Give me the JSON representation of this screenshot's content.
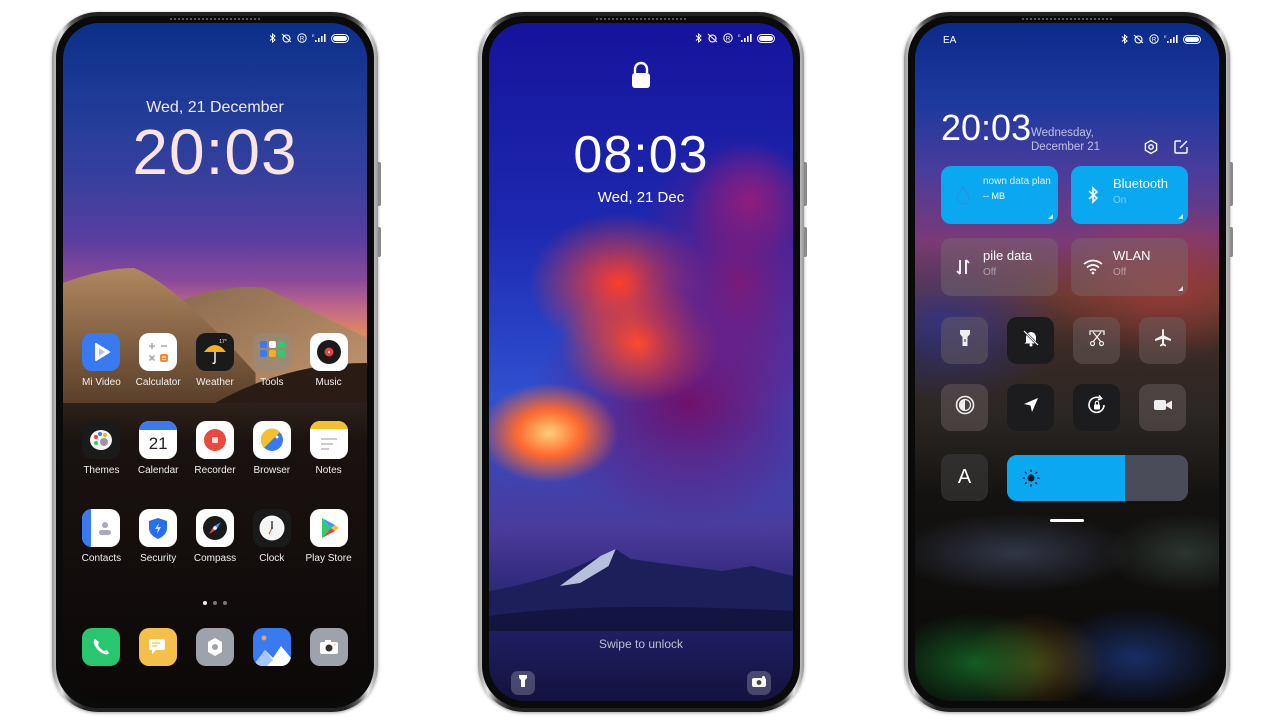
{
  "status_bar": {
    "icons": [
      "bluetooth-icon",
      "silent-alarm-icon",
      "registered-r-icon",
      "signal-e-icon",
      "battery-icon"
    ],
    "signal_label": "E"
  },
  "home_screen": {
    "date": "Wed, 21 December",
    "time": "20:03",
    "apps": [
      {
        "label": "Mi Video",
        "icon": "mi-video-icon"
      },
      {
        "label": "Calculator",
        "icon": "calculator-icon"
      },
      {
        "label": "Weather",
        "icon": "weather-icon",
        "badge": "17°"
      },
      {
        "label": "Tools",
        "icon": "tools-folder-icon"
      },
      {
        "label": "Music",
        "icon": "music-icon"
      },
      {
        "label": "Themes",
        "icon": "themes-icon"
      },
      {
        "label": "Calendar",
        "icon": "calendar-icon",
        "day": "21"
      },
      {
        "label": "Recorder",
        "icon": "recorder-icon"
      },
      {
        "label": "Browser",
        "icon": "browser-icon"
      },
      {
        "label": "Notes",
        "icon": "notes-icon"
      },
      {
        "label": "Contacts",
        "icon": "contacts-icon"
      },
      {
        "label": "Security",
        "icon": "security-icon"
      },
      {
        "label": "Compass",
        "icon": "compass-icon"
      },
      {
        "label": "Clock",
        "icon": "clock-icon"
      },
      {
        "label": "Play Store",
        "icon": "play-store-icon"
      }
    ],
    "page_indicator": {
      "pages": 3,
      "current": 1
    },
    "dock": [
      {
        "name": "phone",
        "icon": "phone-icon"
      },
      {
        "name": "messages",
        "icon": "messages-icon"
      },
      {
        "name": "settings",
        "icon": "settings-icon"
      },
      {
        "name": "gallery",
        "icon": "gallery-icon"
      },
      {
        "name": "camera",
        "icon": "camera-icon"
      }
    ]
  },
  "lock_screen": {
    "time": "08:03",
    "date": "Wed, 21 Dec",
    "swipe_hint": "Swipe to unlock",
    "shortcuts": [
      "flashlight-icon",
      "camera-icon"
    ]
  },
  "control_center": {
    "carrier": "EA",
    "time": "20:03",
    "date_line1": "Wednesday,",
    "date_line2": "December 21",
    "big_tiles": [
      {
        "title": "nown data plan",
        "subtitle": "-- MB",
        "state": "on",
        "icon": "data-drop-icon"
      },
      {
        "title": "Bluetooth",
        "subtitle": "On",
        "state": "on",
        "icon": "bluetooth-icon"
      },
      {
        "title": "pile data",
        "subtitle": "Off",
        "state": "off",
        "icon": "mobile-data-icon"
      },
      {
        "title": "WLAN",
        "subtitle": "Off",
        "state": "off",
        "icon": "wifi-icon"
      }
    ],
    "small_tiles": [
      {
        "name": "flashlight",
        "icon": "flashlight-icon",
        "state": "off"
      },
      {
        "name": "silent",
        "icon": "bell-off-icon",
        "state": "on"
      },
      {
        "name": "screenshot",
        "icon": "scissors-screenshot-icon",
        "state": "off"
      },
      {
        "name": "airplane-mode",
        "icon": "airplane-icon",
        "state": "off"
      },
      {
        "name": "dark-mode",
        "icon": "contrast-icon",
        "state": "off"
      },
      {
        "name": "location",
        "icon": "location-arrow-icon",
        "state": "on"
      },
      {
        "name": "rotation-lock",
        "icon": "rotation-lock-icon",
        "state": "on"
      },
      {
        "name": "screen-record",
        "icon": "video-camera-icon",
        "state": "off"
      }
    ],
    "auto_brightness_label": "A",
    "brightness_percent": 65,
    "accent_color": "#0aa8f0"
  }
}
